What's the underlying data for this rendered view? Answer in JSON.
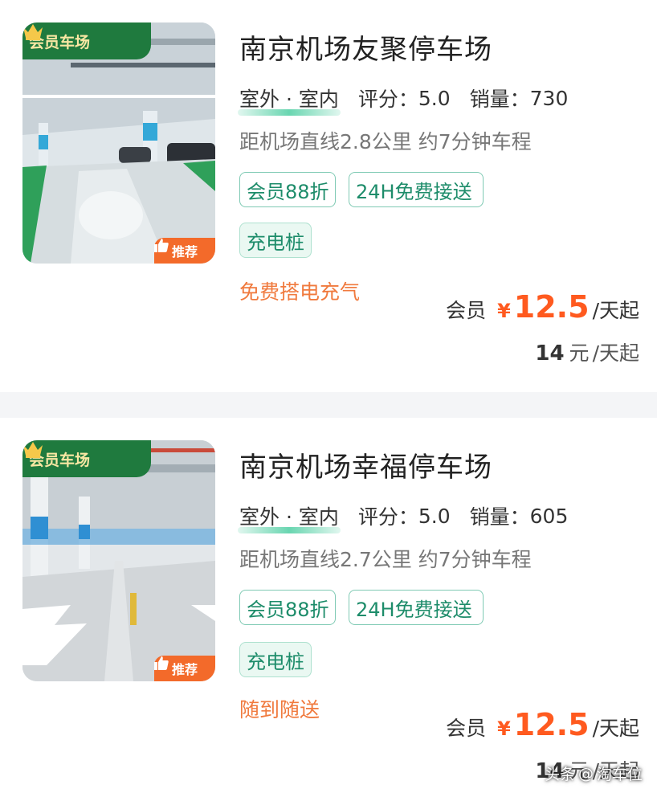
{
  "listings": [
    {
      "badge_member": "会员车场",
      "badge_recommend": "推荐",
      "title": "南京机场友聚停车场",
      "indoor_outdoor": "室外 · 室内",
      "rating_label": "评分：",
      "rating": "5.0",
      "sales_label": "销量：",
      "sales": "730",
      "distance": "距机场直线2.8公里 约7分钟车程",
      "tags": [
        "会员88折",
        "24H免费接送"
      ],
      "feature": "充电桩",
      "perk": "免费搭电充气",
      "member_label": "会员",
      "currency": "¥",
      "member_price": "12.5",
      "price_unit": "/天起",
      "regular_price": "14",
      "regular_currency": "元",
      "regular_unit": "/天起"
    },
    {
      "badge_member": "会员车场",
      "badge_recommend": "推荐",
      "title": "南京机场幸福停车场",
      "indoor_outdoor": "室外 · 室内",
      "rating_label": "评分：",
      "rating": "5.0",
      "sales_label": "销量：",
      "sales": "605",
      "distance": "距机场直线2.7公里 约7分钟车程",
      "tags": [
        "会员88折",
        "24H免费接送"
      ],
      "feature": "充电桩",
      "perk": "随到随送",
      "member_label": "会员",
      "currency": "¥",
      "member_price": "12.5",
      "price_unit": "/天起",
      "regular_price": "14",
      "regular_currency": "元",
      "regular_unit": "/天起"
    }
  ],
  "watermark": {
    "source": "头条",
    "at": "@",
    "author": "淘车位"
  },
  "colors": {
    "accent_price": "#ff5a1f",
    "tag_green": "#1d8c6a",
    "perk_orange": "#f07a3e",
    "member_badge": "#1f7a3e",
    "recommend_badge": "#f36a2a"
  },
  "icons": [
    "crown-icon",
    "thumbs-up-icon"
  ]
}
